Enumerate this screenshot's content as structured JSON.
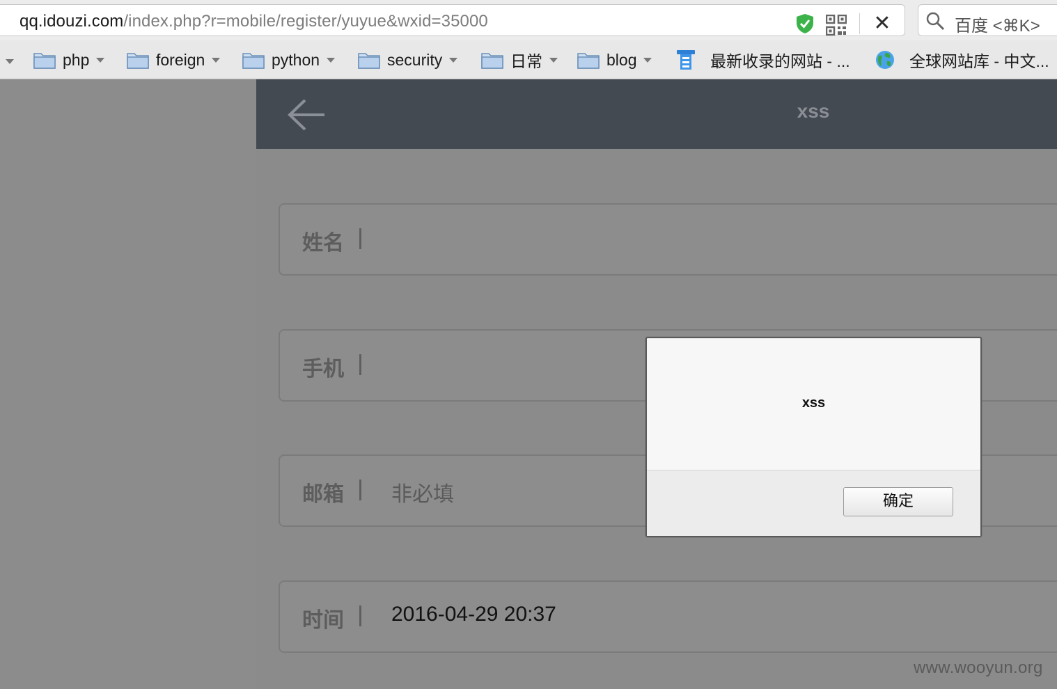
{
  "browser": {
    "url_host": "qq.idouzi.com",
    "url_path": "/index.php?r=mobile/register/yuyue&wxid=35000",
    "search_placeholder": "百度 <⌘K>",
    "page_info_glyph": ")",
    "stop_glyph": "✕",
    "icons": [
      "page-info-icon",
      "shield-icon",
      "qr-code-icon",
      "stop-icon",
      "search-icon"
    ],
    "accent_shield": "#3cb34a"
  },
  "bookmarks": [
    {
      "label": "php",
      "type": "folder"
    },
    {
      "label": "foreign",
      "type": "folder"
    },
    {
      "label": "python",
      "type": "folder"
    },
    {
      "label": "security",
      "type": "folder"
    },
    {
      "label": "日常",
      "type": "folder"
    },
    {
      "label": "blog",
      "type": "folder"
    },
    {
      "label": "最新收录的网站 - ...",
      "type": "site"
    },
    {
      "label": "全球网站库 - 中文...",
      "type": "site"
    }
  ],
  "header": {
    "title": "xss",
    "bg_color": "#444a52"
  },
  "form": {
    "fields": [
      {
        "label": "姓名",
        "value": ""
      },
      {
        "label": "手机",
        "value": ""
      },
      {
        "label": "邮箱",
        "value": "",
        "placeholder": "非必填"
      },
      {
        "label": "时间",
        "value": "2016-04-29 20:37"
      }
    ]
  },
  "dialog": {
    "message": "xss",
    "ok_label": "确定"
  },
  "watermark": "www.wooyun.org"
}
